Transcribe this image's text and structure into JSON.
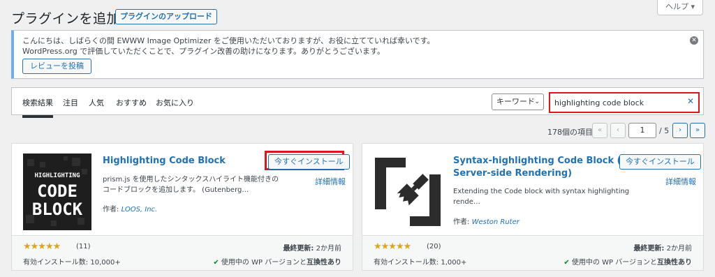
{
  "header": {
    "title": "プラグインを追加",
    "upload_button": "プラグインのアップロード",
    "help_button": "ヘルプ ▾"
  },
  "notice": {
    "line1": "こんにちは、しばらくの間 EWWW Image Optimizer をご使用いただいておりますが、お役に立てていれば幸いです。",
    "line2": "WordPress.org で評価していただくことで、プラグイン改善の助けになります。ありがとうございます。",
    "review_button": "レビューを投稿"
  },
  "filter": {
    "tabs": [
      {
        "label": "検索結果",
        "active": true
      },
      {
        "label": "注目",
        "active": false
      },
      {
        "label": "人気",
        "active": false
      },
      {
        "label": "おすすめ",
        "active": false
      },
      {
        "label": "お気に入り",
        "active": false
      }
    ],
    "search_type": "キーワード",
    "search_value": "highlighting code block"
  },
  "pagination": {
    "count": "178個の項目",
    "first": "«",
    "prev": "‹",
    "current": "1",
    "total": "/ 5",
    "next": "›",
    "last": "»"
  },
  "plugins": [
    {
      "title": "Highlighting Code Block",
      "install": "今すぐインストール",
      "details": "詳細情報",
      "desc1": "prism.js を使用したシンタックスハイライト機能付きの",
      "desc2": "コードブロックを追加します。 (Gutenberg…",
      "author_label": "作者:",
      "author": "LOOS, Inc.",
      "thumb_line1": "HIGHLIGHTING",
      "thumb_line2": "CODE",
      "thumb_line3": "BLOCK",
      "stars": "★★★★★",
      "rating_count": "(11)",
      "installs": "有効インストール数: 10,000+",
      "updated_label": "最終更新:",
      "updated": "2か月前",
      "compat_check": "✔",
      "compat_text": "使用中の WP バージョンと",
      "compat_bold": "互換性あり"
    },
    {
      "title_line1": "Syntax-highlighting Code Block (with",
      "title_line2": "Server-side Rendering)",
      "install": "今すぐインストール",
      "details": "詳細情報",
      "desc1": "Extending the Code block with syntax highlighting",
      "desc2": "rende…",
      "author_label": "作者:",
      "author": "Weston Ruter",
      "stars": "★★★★★",
      "rating_count": "(20)",
      "installs": "有効インストール数: 1,000+",
      "updated_label": "最終更新:",
      "updated": "2か月前",
      "compat_check": "✔",
      "compat_text": "使用中の WP バージョンと",
      "compat_bold": "互換性あり"
    }
  ],
  "colors": {
    "accent": "#2271b1",
    "highlight": "#e0141e",
    "star": "#dba617",
    "ok": "#008a20"
  }
}
